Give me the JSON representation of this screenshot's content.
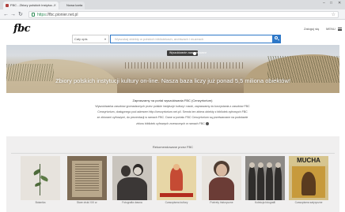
{
  "browser": {
    "tabs": [
      {
        "label": "FBC - Zbiory polskich instytuc..."
      },
      {
        "label": "Nowa karta"
      }
    ],
    "url_secure_label": "https",
    "url": "fbc.pionier.net.pl"
  },
  "header": {
    "logo": "fbc",
    "lang_label": "Zaloguj się",
    "menu_label": "MENU"
  },
  "search": {
    "scope_value": "Cały opis",
    "placeholder": "Wyszukaj obiekty w polskich bibliotekach, archiwach i muzeach"
  },
  "hero": {
    "badge": "Wyszukiwanie zaawansowane",
    "headline": "Zbiory polskich instytucji kultury on-line. Nasza baza liczy już ponad 5,5 miliona obiektów!"
  },
  "intro": {
    "title": "Zapraszamy na portal wyszukiwania FBC (Cenzyrtorium)",
    "lines": [
      "Wyszukiwarka zasobów gromadzonych przez polskie instytucje kultury i nauki, zapraszamy do korzystania z zasobów FBC",
      "Cenzyrtorium, dostępnego pod adresem http://cenzyrtorium.net.pl/. Serwis ten zbiera obiekty z bibliotek cyfrowych FBC",
      "ze zbiorami cyfrowymi, do prezentacji w ramach FBC. Dane w portalu FBC Cenzyrtorium są przetwarzane na podstawie",
      "zbioru bibliotek cyfrowych zrzeszonych w ramach FBC"
    ]
  },
  "recommended": {
    "title": "Rekomendowane przez FBC",
    "items": [
      {
        "label": "Botanika"
      },
      {
        "label": "Stare druki XIX w."
      },
      {
        "label": "Fotografia dawna"
      },
      {
        "label": "Czasopisma kultury"
      },
      {
        "label": "Portrety historyczne"
      },
      {
        "label": "Kolekcja fotografii"
      },
      {
        "label": "Czasopisma satyryczne"
      }
    ]
  }
}
